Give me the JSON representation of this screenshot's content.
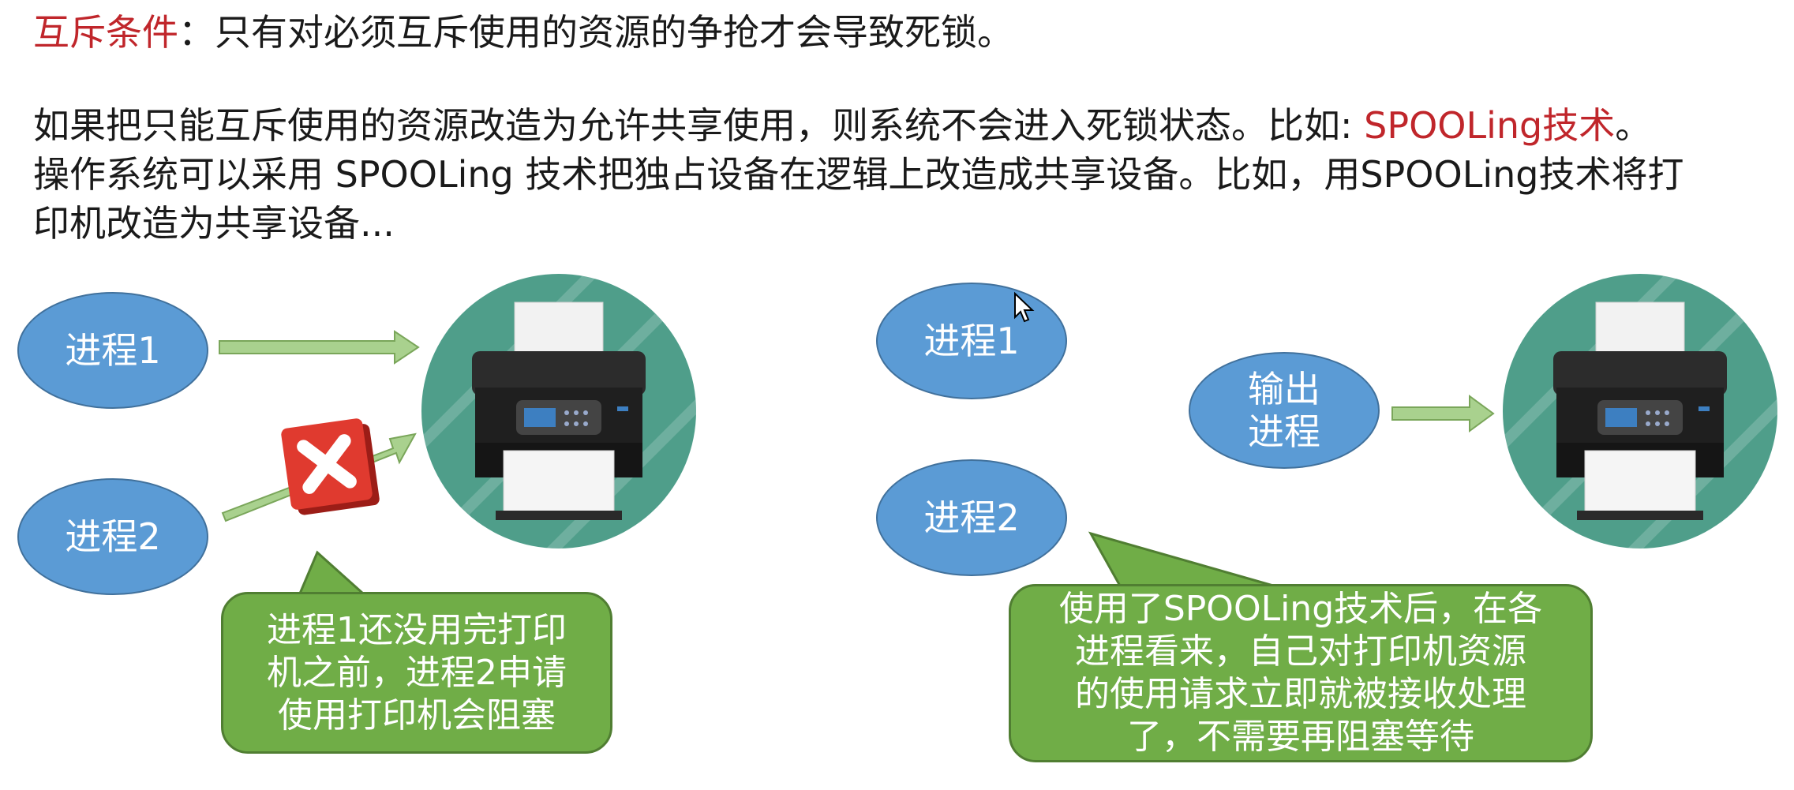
{
  "text": {
    "line1_red": "互斥条件",
    "line1_rest": "：只有对必须互斥使用的资源的争抢才会导致死锁。",
    "line2_main": "如果把只能互斥使用的资源改造为允许共享使用，则系统不会进入死锁状态。比如: ",
    "line2_red": "SPOOLing技术",
    "line2_end": "。",
    "line3": "操作系统可以采用 SPOOLing 技术把独占设备在逻辑上改造成共享设备。比如，用SPOOLing技术将打",
    "line4": "印机改造为共享设备..."
  },
  "left_diagram": {
    "process1": "进程1",
    "process2": "进程2",
    "callout_lines": [
      "进程1还没用完打印",
      "机之前，进程2申请",
      "使用打印机会阻塞"
    ]
  },
  "right_diagram": {
    "process1": "进程1",
    "process2": "进程2",
    "output_process": "输出\n进程",
    "callout_lines": [
      "使用了SPOOLing技术后，在各",
      "进程看来，自己对打印机资源",
      "的使用请求立即就被接收处理",
      "了，不需要再阻塞等待"
    ]
  },
  "colors": {
    "text_red": "#c0262b",
    "process_blue": "#5b9bd5",
    "arrow_green": "#a9d18e",
    "callout_green": "#70ad47",
    "printer_circle": "#4f9e8a",
    "block_red": "#e03a2f"
  },
  "icons": {
    "printer": "printer-icon",
    "block": "close-icon",
    "cursor": "mouse-cursor-icon"
  }
}
